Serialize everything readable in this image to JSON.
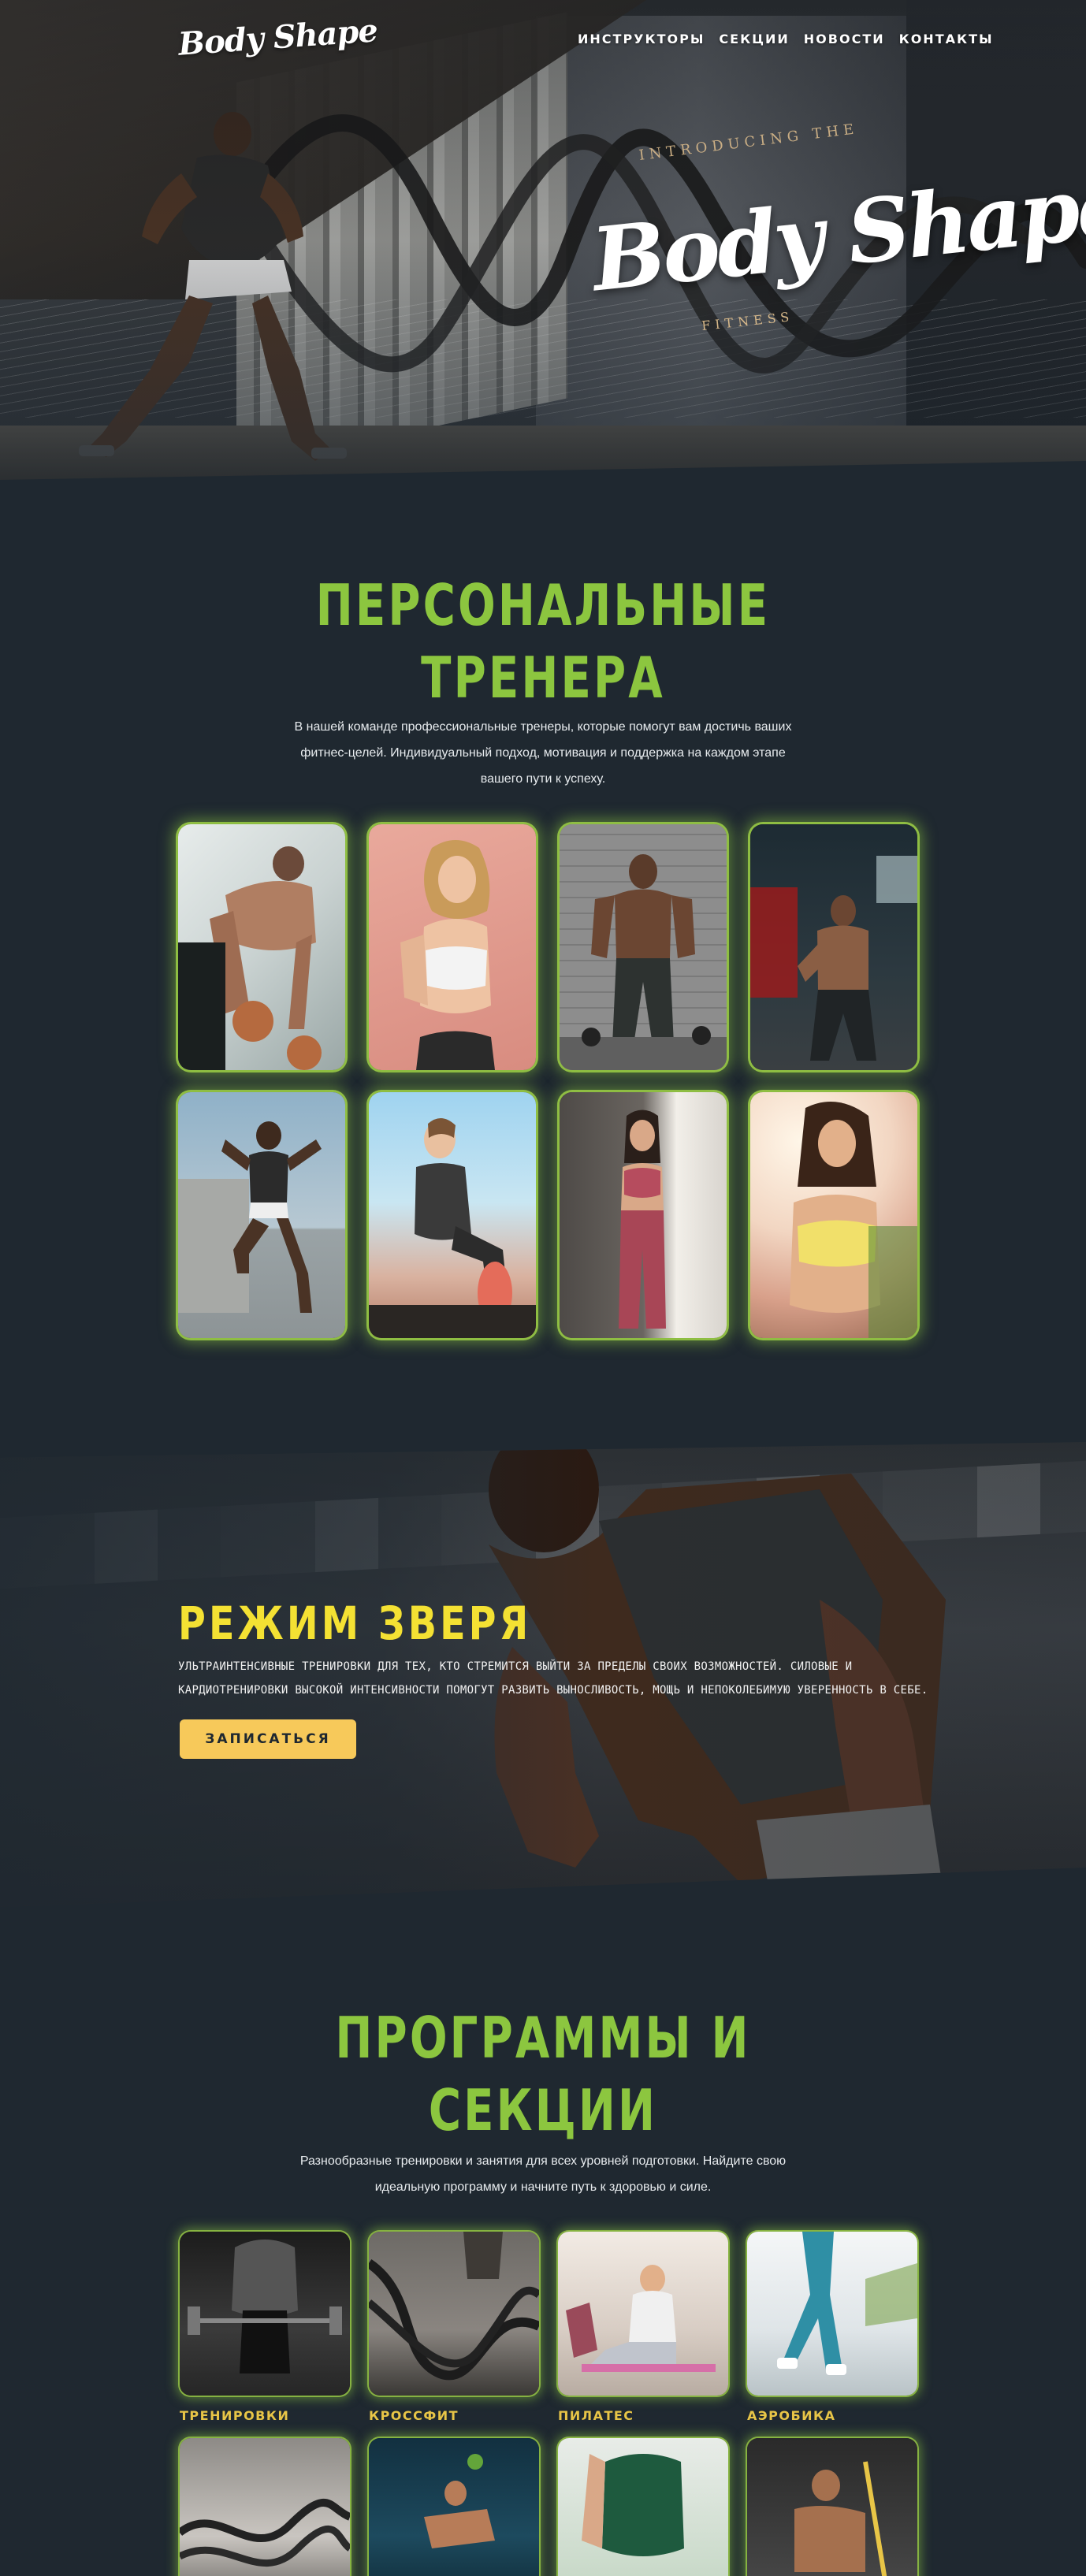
{
  "header": {
    "logo": "Body Shape",
    "nav": [
      "ИНСТРУКТОРЫ",
      "СЕКЦИИ",
      "НОВОСТИ",
      "КОНТАКТЫ"
    ]
  },
  "hero": {
    "intro": "INTRODUCING THE",
    "brand": "Body Shape",
    "tagline": "FITNESS"
  },
  "trainers": {
    "title_line1": "ПЕРСОНАЛЬНЫЕ",
    "title_line2": "ТРЕНЕРА",
    "desc_line1": "В нашей команде профессиональные тренеры, которые помогут вам достичь ваших",
    "desc_line2": "фитнес-целей. Индивидуальный подход, мотивация и поддержка на каждом этапе",
    "desc_line3": "вашего пути к успеху."
  },
  "beast": {
    "title": "РЕЖИМ ЗВЕРЯ",
    "text_line1": "УЛЬТРАИНТЕНСИВНЫЕ ТРЕНИРОВКИ ДЛЯ ТЕХ, КТО СТРЕМИТСЯ ВЫЙТИ ЗА ПРЕДЕЛЫ СВОИХ ВОЗМОЖНОСТЕЙ. СИЛОВЫЕ И",
    "text_line2": "КАРДИОТРЕНИРОВКИ ВЫСОКОЙ ИНТЕНСИВНОСТИ ПОМОГУТ РАЗВИТЬ ВЫНОСЛИВОСТЬ, МОЩЬ И НЕПОКОЛЕБИМУЮ УВЕРЕННОСТЬ В СЕБЕ.",
    "button": "ЗАПИСАТЬСЯ"
  },
  "programs": {
    "title_line1": "ПРОГРАММЫ И",
    "title_line2": "СЕКЦИИ",
    "desc_line1": "Разнообразные тренировки и занятия для всех уровней подготовки. Найдите свою",
    "desc_line2": "идеальную программу и начните путь к здоровью и силе.",
    "items": [
      {
        "label": "ТРЕНИРОВКИ"
      },
      {
        "label": "КРОССФИТ"
      },
      {
        "label": "ПИЛАТЕС"
      },
      {
        "label": "АЭРОБИКА"
      }
    ]
  },
  "colors": {
    "background": "#1f2830",
    "accent_green": "#8cc63f",
    "accent_yellow": "#f4e133",
    "button": "#f7c95a",
    "label": "#e8c547"
  }
}
